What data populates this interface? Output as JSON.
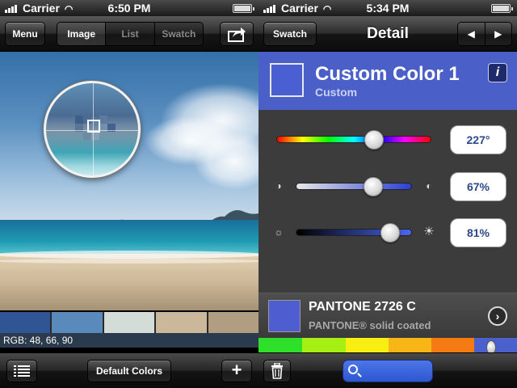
{
  "status_left": {
    "carrier": "Carrier",
    "time": "6:50 PM"
  },
  "status_right": {
    "carrier": "Carrier",
    "time": "5:34 PM"
  },
  "left_nav": {
    "menu_label": "Menu",
    "segments": [
      {
        "label": "Image",
        "active": true
      },
      {
        "label": "List",
        "active": false
      },
      {
        "label": "Swatch",
        "active": false
      }
    ]
  },
  "palette": {
    "swatches": [
      "#2f5594",
      "#5a89bb",
      "#d4dcd7",
      "#cbb79a",
      "#b09d82"
    ],
    "rgb_readout": "RGB: 48, 66, 90"
  },
  "left_toolbar": {
    "default_colors_label": "Default Colors"
  },
  "right_nav": {
    "back_label": "Swatch",
    "title": "Detail"
  },
  "color_detail": {
    "name": "Custom Color 1",
    "type": "Custom",
    "preview_color": "#4a5fd1",
    "header_color": "#4a5fc7",
    "hue": {
      "value": 0.63,
      "label": "227°"
    },
    "saturation": {
      "value": 0.67,
      "label": "67%"
    },
    "brightness": {
      "value": 0.81,
      "label": "81%"
    }
  },
  "pantone": {
    "name": "PANTONE 2726 C",
    "subtitle": "PANTONE® solid coated",
    "swatch_color": "#4e5ed0",
    "strip": [
      "#2fe02a",
      "#a6ef15",
      "#f9ee11",
      "#f7b616",
      "#f57a12",
      "#4a60cc"
    ],
    "strip_position": 0.9
  }
}
